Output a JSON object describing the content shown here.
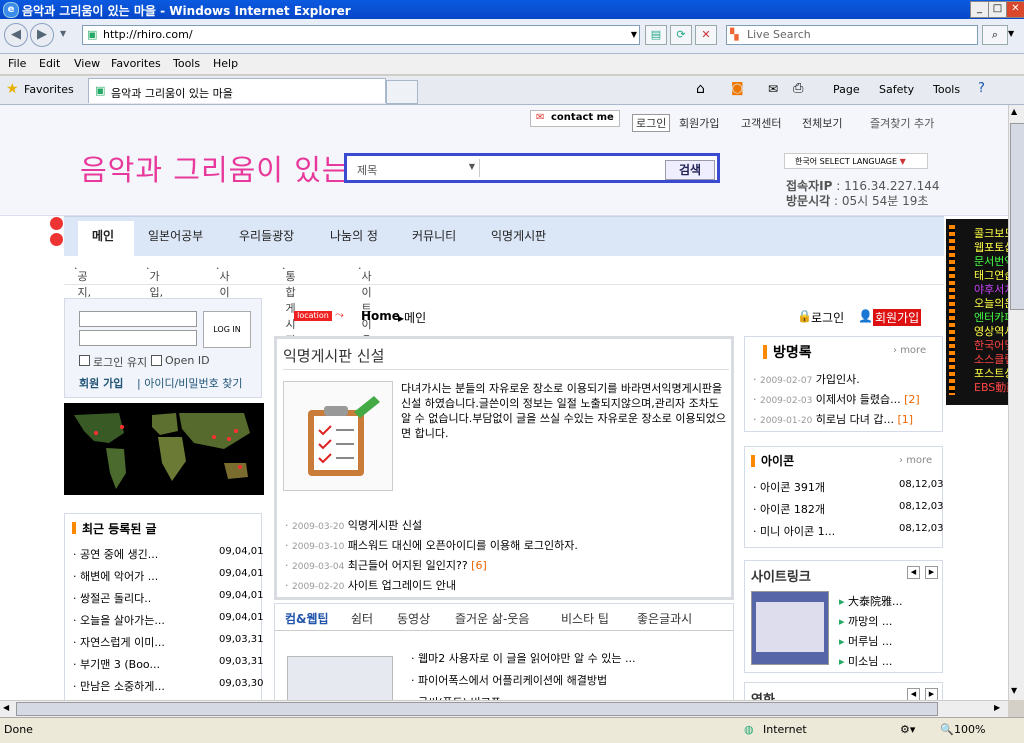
{
  "window": {
    "title": "음악과 그리움이 있는 마을 - Windows Internet Explorer"
  },
  "address": {
    "url": "http://rhiro.com/",
    "search_placeholder": "Live Search"
  },
  "menu": [
    "File",
    "Edit",
    "View",
    "Favorites",
    "Tools",
    "Help"
  ],
  "favbar": {
    "favorites": "Favorites",
    "tab_title": "음악과 그리움이 있는 마을",
    "commands": [
      "Page",
      "Safety",
      "Tools"
    ]
  },
  "site": {
    "logo": "음악과 그리움이 있는 마을",
    "contact": "contact me",
    "toplinks": [
      "로그인",
      "회원가입",
      "고객센터",
      "전체보기",
      "즐겨찾기 추가"
    ],
    "search": {
      "select": "제목",
      "button": "검색"
    },
    "language": "한국어 SELECT LANGUAGE",
    "ip_label": "접속자IP",
    "ip_value": "116.34.227.144",
    "visit_label": "방문시각",
    "visit_value": "05시 54분 19초",
    "nav": [
      "메인",
      "일본어공부",
      "우리들광장",
      "나눔의 정",
      "커뮤니티",
      "익명게시판"
    ],
    "subnav": [
      "공지,알림",
      "가입,등업",
      "사이트맵",
      "통합게시판",
      "사이트 이용 안내"
    ],
    "login": {
      "btn": "LOG IN",
      "remember": "로그인 유지",
      "openid": "Open ID",
      "join": "회원 가입",
      "find": "아이디/비밀번호 찾기"
    },
    "recent_title": "최근 등록된 글",
    "recent": [
      {
        "t": "공연 중에 생긴...",
        "d": "09,04,01"
      },
      {
        "t": "해변에 악어가 ...",
        "d": "09,04,01"
      },
      {
        "t": "쌍절곤 돌리다..",
        "d": "09,04,01"
      },
      {
        "t": "오늘을 살아가는...",
        "d": "09,04,01"
      },
      {
        "t": "자연스럽게 이미...",
        "d": "09,03,31"
      },
      {
        "t": "부기맨 3 (Boo...",
        "d": "09,03,31"
      },
      {
        "t": "만남은 소중하게...",
        "d": "09,03,30"
      }
    ],
    "location": {
      "tag": "location",
      "home": "Home",
      "page": "메인",
      "login": "로그인",
      "join": "회원가입"
    },
    "feature": {
      "title": "익명게시판 신설",
      "body": "다녀가시는 분들의 자유로운 장소로 이용되기를 바라면서익명게시판을 신설 하였습니다.글쓴이의 정보는 일절 노출되지않으며,관리자 조차도 알 수 없습니다.부담없이 글을 쓰실 수있는 자유로운 장소로 이용되었으면 합니다."
    },
    "notices": [
      {
        "d": "2009-03-20",
        "t": "익명게시판 신설",
        "c": ""
      },
      {
        "d": "2009-03-10",
        "t": "패스워드 대신에 오픈아이디를 이용해 로그인하자.",
        "c": ""
      },
      {
        "d": "2009-03-04",
        "t": "최근들어 어지된 일인지??",
        "c": "[6]"
      },
      {
        "d": "2009-02-20",
        "t": "사이트 업그레이드 안내",
        "c": ""
      }
    ],
    "tabs": [
      "컴&웹팁",
      "쉼터",
      "동영상",
      "즐거운 삶-웃음",
      "비스타 팁",
      "좋은글과시"
    ],
    "tab_items": [
      "웹마2 사용자로 이 글을 읽어야만 알 수 있는 ...",
      "파이어폭스에서 어플리케이션에 해결방법",
      "글씨(폰트) 비교표"
    ],
    "guestbook": {
      "title": "방명록",
      "more": "more",
      "items": [
        {
          "d": "2009-02-07",
          "t": "가입인사.",
          "c": ""
        },
        {
          "d": "2009-02-03",
          "t": "이제서야 들렸습...",
          "c": "[2]"
        },
        {
          "d": "2009-01-20",
          "t": "히로님 다녀 갑...",
          "c": "[1]"
        }
      ]
    },
    "icons": {
      "title": "아이콘",
      "more": "more",
      "items": [
        {
          "t": "아이콘 391개",
          "d": "08,12,03"
        },
        {
          "t": "아이콘 182개",
          "d": "08,12,03"
        },
        {
          "t": "미니 아이콘 1...",
          "d": "08,12,03"
        }
      ]
    },
    "sitelink": {
      "title": "사이트링크",
      "items": [
        "大泰院雅...",
        "까망의 ...",
        "머루님 ...",
        "미소님 ..."
      ]
    },
    "movie": {
      "title": "영화"
    },
    "ebs": [
      "콜크보드",
      "웹포토샵",
      "문서번역",
      "태그연습",
      "야후서치",
      "오늘의운",
      "엔터카페",
      "영상역사",
      "한국어및",
      "소스클럽",
      "포스트상",
      "EBS動劃"
    ]
  },
  "status": {
    "left": "Done",
    "zone": "Internet",
    "zoom": "100%"
  },
  "colors": {
    "accent": "#e8389b",
    "search_border": "#3a4bd1",
    "nav_bg": "#dbe6f7"
  }
}
